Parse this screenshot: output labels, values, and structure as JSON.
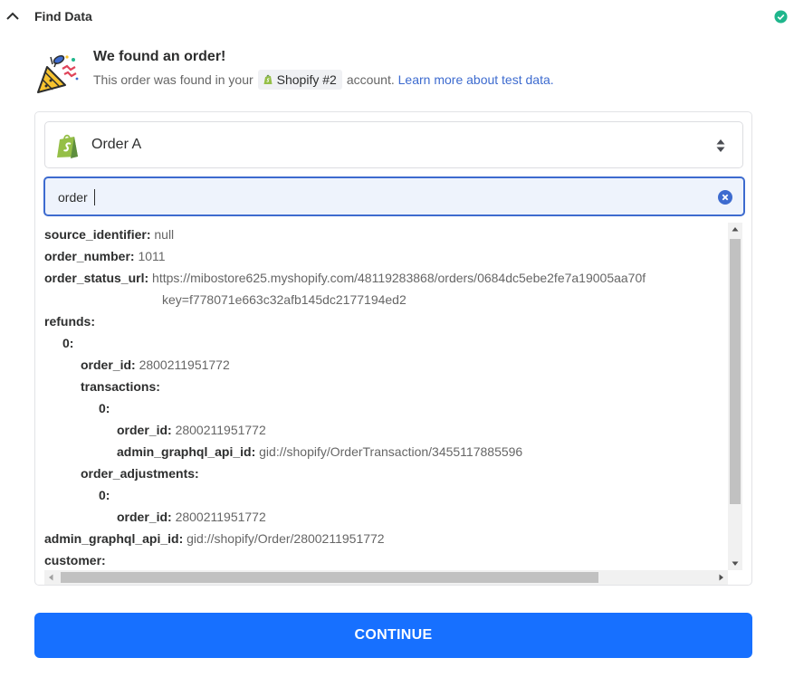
{
  "header": {
    "title": "Find Data",
    "collapse_icon": "chevron-up-icon",
    "status_icon": "check-circle-icon",
    "status_color": "#1fb68c"
  },
  "result": {
    "icon": "party-popper-icon",
    "title": "We found an order!",
    "text_before": "This order was found in your",
    "account_icon": "shopify-icon",
    "account_name": "Shopify #2",
    "text_after": "account.",
    "link_text": "Learn more about test data",
    "link_suffix": "."
  },
  "sample_select": {
    "icon": "shopify-logo-icon",
    "label": "Order A",
    "arrows_icon": "sort-arrows-icon"
  },
  "search": {
    "value": "order",
    "clear_icon": "clear-circle-icon"
  },
  "fields": [
    {
      "key": "source_identifier:",
      "value": "null",
      "indent": 0
    },
    {
      "key": "order_number:",
      "value": "1011",
      "indent": 0
    },
    {
      "key": "order_status_url:",
      "value": "https://mibostore625.myshopify.com/48119283868/orders/0684dc5ebe2fe7a19005aa70f",
      "value_cont": "key=f778071e663c32afb145dc2177194ed2",
      "indent": 0
    },
    {
      "key": "refunds:",
      "value": "",
      "indent": 0
    },
    {
      "key": "0:",
      "value": "",
      "indent": 1
    },
    {
      "key": "order_id:",
      "value": "2800211951772",
      "indent": 2
    },
    {
      "key": "transactions:",
      "value": "",
      "indent": 2
    },
    {
      "key": "0:",
      "value": "",
      "indent": 3
    },
    {
      "key": "order_id:",
      "value": "2800211951772",
      "indent": 4
    },
    {
      "key": "admin_graphql_api_id:",
      "value": "gid://shopify/OrderTransaction/3455117885596",
      "indent": 4
    },
    {
      "key": "order_adjustments:",
      "value": "",
      "indent": 2
    },
    {
      "key": "0:",
      "value": "",
      "indent": 3
    },
    {
      "key": "order_id:",
      "value": "2800211951772",
      "indent": 4
    },
    {
      "key": "admin_graphql_api_id:",
      "value": "gid://shopify/Order/2800211951772",
      "indent": 0
    },
    {
      "key": "customer:",
      "value": "",
      "indent": 0
    }
  ],
  "continue_label": "CONTINUE",
  "colors": {
    "primary": "#1770ff",
    "link": "#3d6bcf",
    "search_border": "#3d6bcf",
    "search_bg": "#eef3fc",
    "shopify_green": "#95bf47"
  }
}
